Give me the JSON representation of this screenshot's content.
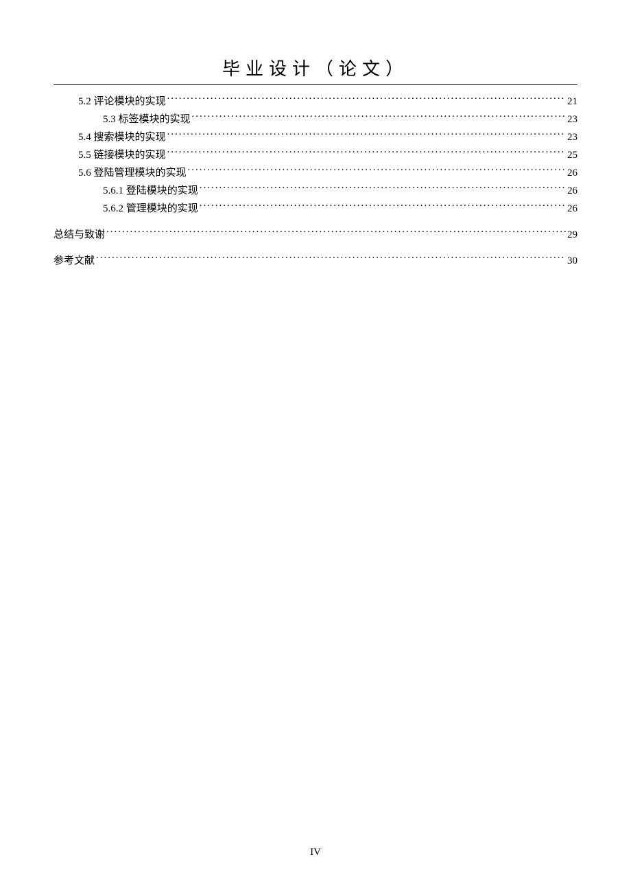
{
  "header": {
    "title": "毕业设计（论文）"
  },
  "toc": {
    "entries": [
      {
        "indent": 1,
        "label": "5.2  评论模块的实现",
        "page": "21",
        "spacer": false
      },
      {
        "indent": 2,
        "label": "5.3  标签模块的实现",
        "page": "23",
        "spacer": false
      },
      {
        "indent": 1,
        "label": "5.4  搜索模块的实现",
        "page": "23",
        "spacer": false
      },
      {
        "indent": 1,
        "label": "5.5  链接模块的实现",
        "page": "25",
        "spacer": false
      },
      {
        "indent": 1,
        "label": "5.6  登陆管理模块的实现",
        "page": "26",
        "spacer": false
      },
      {
        "indent": 2,
        "label": "5.6.1  登陆模块的实现",
        "page": "26",
        "spacer": false
      },
      {
        "indent": 2,
        "label": "5.6.2  管理模块的实现",
        "page": "26",
        "spacer": false
      },
      {
        "indent": 0,
        "label": "总结与致谢",
        "page": "29",
        "spacer": true
      },
      {
        "indent": 0,
        "label": "参考文献",
        "page": "30",
        "spacer": true
      }
    ]
  },
  "footer": {
    "page_number": "IV"
  }
}
